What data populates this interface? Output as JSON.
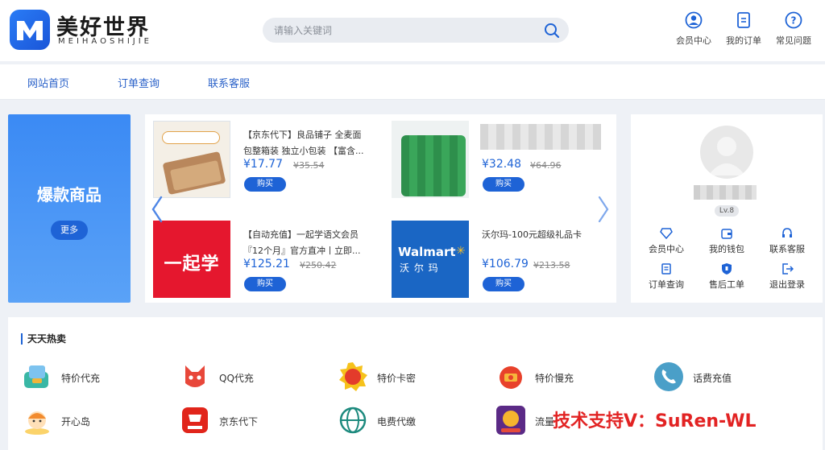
{
  "header": {
    "brand_cn": "美好世界",
    "brand_en": "MEIHAOSHIJIE",
    "search_placeholder": "请输入关键词",
    "links": [
      {
        "label": "会员中心",
        "icon": "user-icon"
      },
      {
        "label": "我的订单",
        "icon": "order-icon"
      },
      {
        "label": "常见问题",
        "icon": "help-icon"
      }
    ]
  },
  "nav": {
    "items": [
      "网站首页",
      "订单查询",
      "联系客服"
    ]
  },
  "featured": {
    "title": "爆款商品",
    "more_label": "更多",
    "products": [
      {
        "name": "【京东代下】良品铺子 全麦面包整箱装 独立小包装 【富含...",
        "price": "¥17.77",
        "old_price": "¥35.54",
        "buy_label": "购买"
      },
      {
        "name": "",
        "price": "¥32.48",
        "old_price": "¥64.96",
        "buy_label": "购买"
      },
      {
        "name": "【自动充值】一起学语文会员『12个月』官方直冲丨立即...",
        "price": "¥125.21",
        "old_price": "¥250.42",
        "buy_label": "购买",
        "img_text": "一起学"
      },
      {
        "name": "沃尔玛-100元超级礼品卡",
        "price": "¥106.79",
        "old_price": "¥213.58",
        "buy_label": "购买",
        "img_text_en": "Walmart",
        "img_text_cn": "沃 尔 玛"
      }
    ]
  },
  "user_panel": {
    "level": "Lv.8",
    "links": [
      {
        "label": "会员中心",
        "icon": "diamond-icon"
      },
      {
        "label": "我的钱包",
        "icon": "wallet-icon"
      },
      {
        "label": "联系客服",
        "icon": "headset-icon"
      },
      {
        "label": "订单查询",
        "icon": "order-list-icon"
      },
      {
        "label": "售后工单",
        "icon": "shield-icon"
      },
      {
        "label": "退出登录",
        "icon": "logout-icon"
      }
    ]
  },
  "daily_hot": {
    "title": "天天热卖",
    "items": [
      {
        "label": "特价代充",
        "icon": "recharge-icon"
      },
      {
        "label": "QQ代充",
        "icon": "qq-fox-icon"
      },
      {
        "label": "特价卡密",
        "icon": "sale-badge-icon"
      },
      {
        "label": "特价慢充",
        "icon": "slow-charge-icon"
      },
      {
        "label": "话费充值",
        "icon": "phone-icon"
      },
      {
        "label": "开心岛",
        "icon": "happy-island-icon"
      },
      {
        "label": "京东代下",
        "icon": "jd-icon"
      },
      {
        "label": "电费代缴",
        "icon": "electricity-icon"
      },
      {
        "label": "流量",
        "icon": "data-flow-icon"
      }
    ]
  },
  "watermark": "技术支持V：SuRen-WL",
  "colors": {
    "accent": "#1e63d6",
    "banner": "#3b8af4",
    "price": "#1e63d6"
  }
}
